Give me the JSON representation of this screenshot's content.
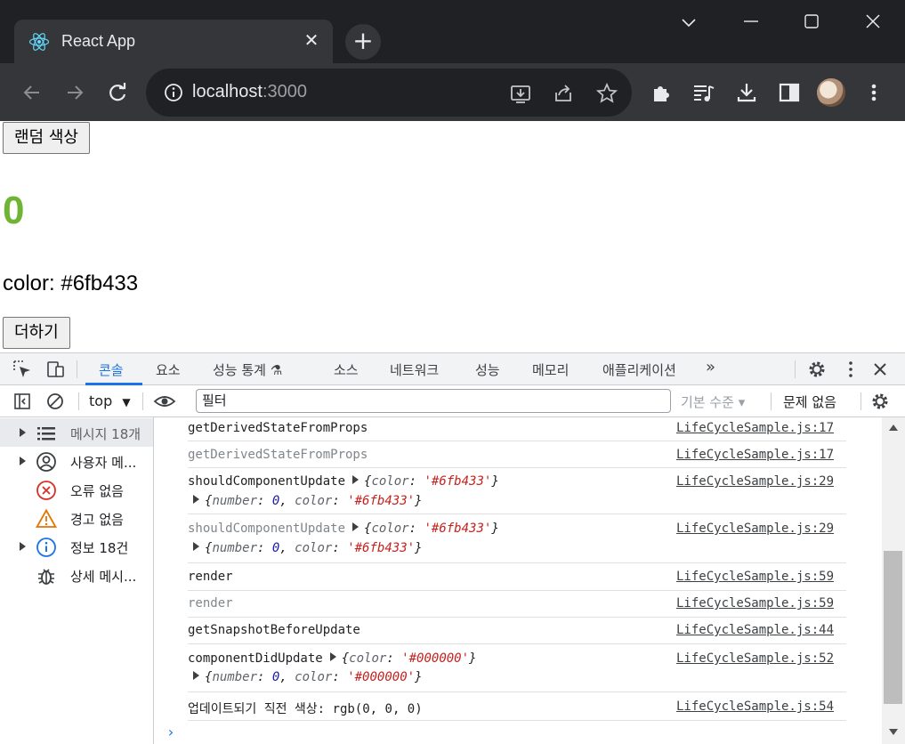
{
  "browser": {
    "tab_title": "React App",
    "tab_close": "✕",
    "new_tab": "+",
    "url_host": "localhost",
    "url_port": ":3000",
    "icons": [
      "react-logo-icon",
      "chevron-down-icon",
      "minimize-icon",
      "maximize-icon",
      "close-window-icon",
      "back-icon",
      "forward-icon",
      "reload-icon",
      "site-info-icon",
      "install-icon",
      "share-icon",
      "bookmark-star-icon",
      "extensions-icon",
      "media-icon",
      "download-icon",
      "side-panel-icon",
      "kebab-menu-icon"
    ]
  },
  "page": {
    "random_color_button": "랜덤 색상",
    "number": "0",
    "number_color": "#6fb433",
    "color_text": "color: #6fb433",
    "add_button": "더하기"
  },
  "devtools": {
    "tabs": [
      {
        "label": "콘솔",
        "active": true
      },
      {
        "label": "요소"
      },
      {
        "label": "성능 통계 ⚗"
      },
      {
        "label": "소스"
      },
      {
        "label": "네트워크"
      },
      {
        "label": "성능"
      },
      {
        "label": "메모리"
      },
      {
        "label": "애플리케이션"
      },
      {
        "label": "»"
      }
    ],
    "context": "top",
    "filter_value": "필터",
    "level": "기본 수준 ▾",
    "issues": "문제 없음",
    "sidebar": [
      {
        "label": "메시지 18개",
        "expandable": true,
        "icon": "list-icon"
      },
      {
        "label": "사용자 메...",
        "expandable": true,
        "icon": "user-icon"
      },
      {
        "label": "오류 없음",
        "expandable": false,
        "icon": "error-icon"
      },
      {
        "label": "경고 없음",
        "expandable": false,
        "icon": "warning-icon"
      },
      {
        "label": "정보 18건",
        "expandable": true,
        "icon": "info-icon"
      },
      {
        "label": "상세 메시...",
        "expandable": false,
        "icon": "bug-icon"
      }
    ],
    "console_rows": [
      {
        "msg": "getDerivedStateFromProps",
        "src": "LifeCycleSample.js:17",
        "dim": false
      },
      {
        "msg": "getDerivedStateFromProps",
        "src": "LifeCycleSample.js:17",
        "dim": true
      },
      {
        "msg": "shouldComponentUpdate",
        "src": "LifeCycleSample.js:29",
        "dim": false,
        "obj1": {
          "color": "'#6fb433'"
        },
        "obj2": {
          "number": "0",
          "color": "'#6fb433'"
        }
      },
      {
        "msg": "shouldComponentUpdate",
        "src": "LifeCycleSample.js:29",
        "dim": true,
        "obj1": {
          "color": "'#6fb433'"
        },
        "obj2": {
          "number": "0",
          "color": "'#6fb433'"
        }
      },
      {
        "msg": "render",
        "src": "LifeCycleSample.js:59",
        "dim": false
      },
      {
        "msg": "render",
        "src": "LifeCycleSample.js:59",
        "dim": true
      },
      {
        "msg": "getSnapshotBeforeUpdate",
        "src": "LifeCycleSample.js:44",
        "dim": false
      },
      {
        "msg": "componentDidUpdate",
        "src": "LifeCycleSample.js:52",
        "dim": false,
        "obj1": {
          "color": "'#000000'"
        },
        "obj2": {
          "number": "0",
          "color": "'#000000'"
        }
      },
      {
        "msg": "업데이트되기 직전 색상:  rgb(0, 0, 0)",
        "src": "LifeCycleSample.js:54",
        "dim": false
      }
    ],
    "prompt": "›"
  }
}
